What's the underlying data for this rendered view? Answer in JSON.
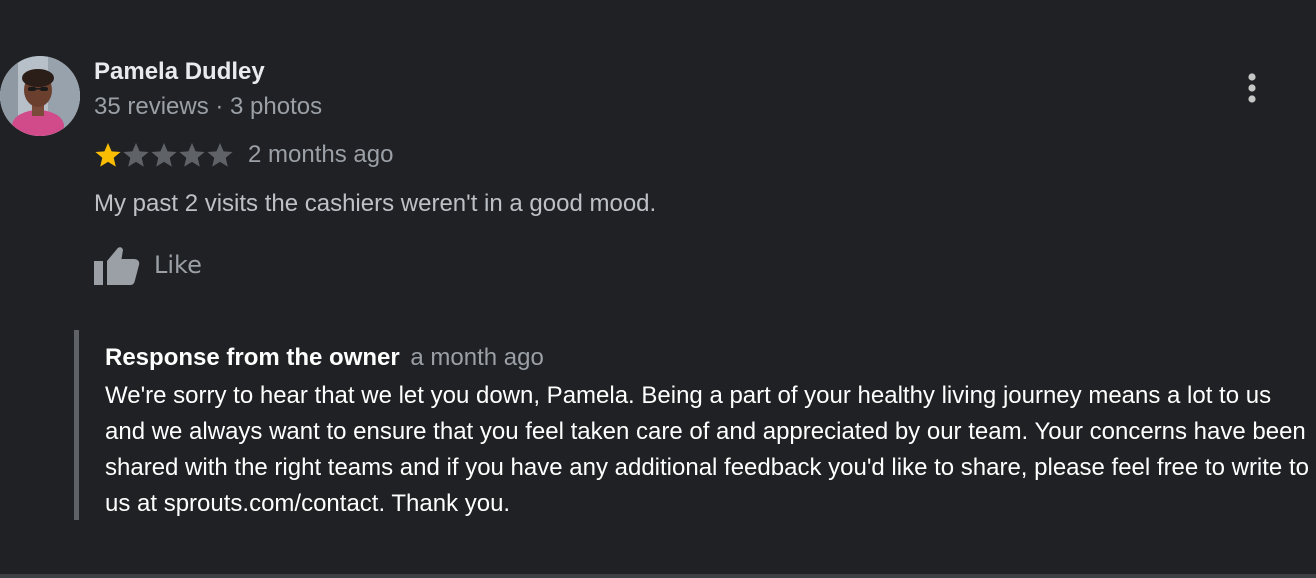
{
  "review": {
    "author": {
      "name": "Pamela Dudley",
      "meta": "35 reviews · 3 photos"
    },
    "rating": 1,
    "rating_max": 5,
    "time": "2 months ago",
    "text": "My past 2 visits the cashiers weren't in a good mood.",
    "like_label": "Like"
  },
  "owner_response": {
    "label": "Response from the owner",
    "time": "a month ago",
    "text": "We're sorry to hear that we let you down, Pamela. Being a part of your healthy living journey means a lot to us and we always want to ensure that you feel taken care of and appreciated by our team. Your concerns have been shared with the right teams and if you have any additional feedback you'd like to share, please feel free to write to us at sprouts.com/contact. Thank you."
  },
  "colors": {
    "background": "#202124",
    "star_filled": "#fbbc04",
    "star_empty": "#5f6368",
    "text_primary": "#e8eaed",
    "text_secondary": "#9aa0a6"
  },
  "icons": {
    "avatar": "avatar-photo",
    "more": "more-vert-icon",
    "like": "thumb-up-icon",
    "star": "star-icon"
  }
}
